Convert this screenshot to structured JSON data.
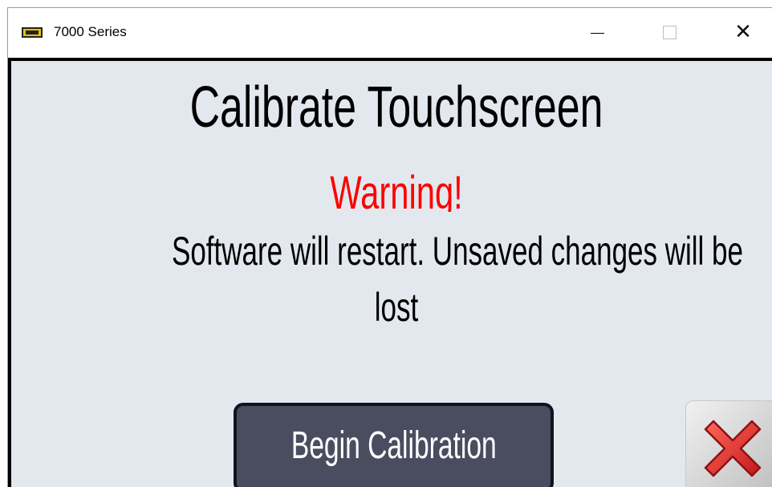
{
  "window": {
    "title": "7000 Series",
    "icon": "7000-series-app-icon",
    "controls": {
      "minimize_icon": "minimize-icon",
      "maximize_icon": "maximize-icon",
      "close_icon": "close-icon",
      "close_glyph": "✕"
    }
  },
  "dialog": {
    "title": "Calibrate Touchscreen",
    "warning": "Warning!",
    "message_line1": "Software will restart. Unsaved changes will be",
    "message_line2": "lost",
    "begin_button_label": "Begin Calibration",
    "cancel_icon": "red-x-icon"
  },
  "colors": {
    "background": "#e3e8ef",
    "warning": "#ff0000",
    "button": "#4a4d5f",
    "button_text": "#ffffff",
    "cancel_x": "#e8352e"
  }
}
